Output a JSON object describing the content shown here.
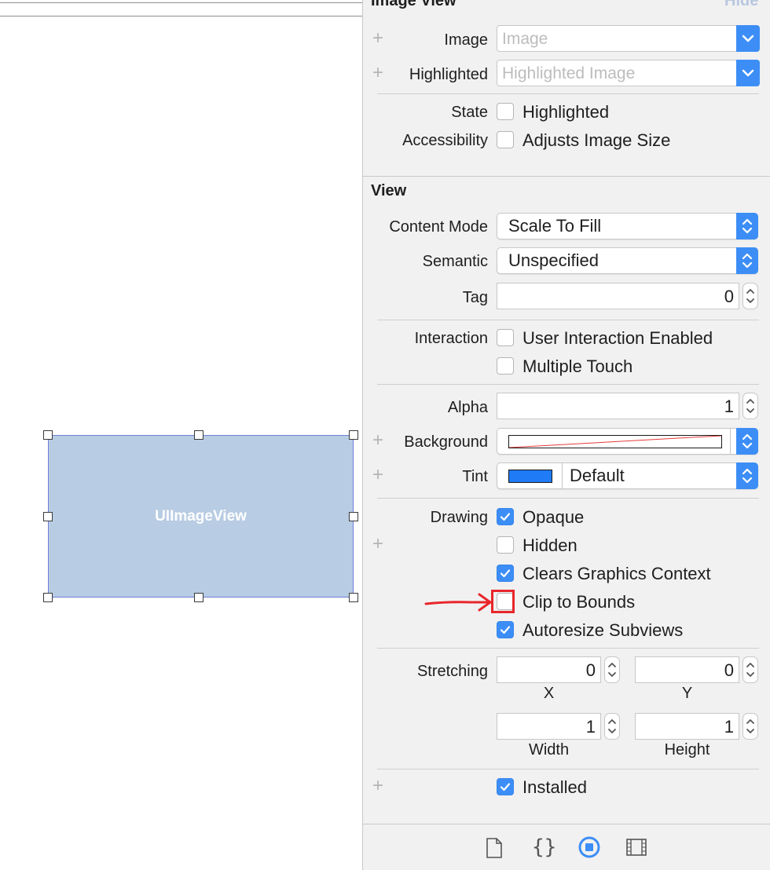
{
  "canvas": {
    "element_label": "UIImageView"
  },
  "image_view_section": {
    "title": "Image View",
    "hide_label": "Hide",
    "image_label": "Image",
    "image_placeholder": "Image",
    "highlighted_label": "Highlighted",
    "highlighted_placeholder": "Highlighted Image",
    "state_label": "State",
    "state_checkbox": {
      "label": "Highlighted",
      "checked": false
    },
    "accessibility_label": "Accessibility",
    "accessibility_checkbox": {
      "label": "Adjusts Image Size",
      "checked": false
    }
  },
  "view_section": {
    "title": "View",
    "content_mode_label": "Content Mode",
    "content_mode_value": "Scale To Fill",
    "semantic_label": "Semantic",
    "semantic_value": "Unspecified",
    "tag_label": "Tag",
    "tag_value": "0",
    "interaction_label": "Interaction",
    "user_interaction": {
      "label": "User Interaction Enabled",
      "checked": false
    },
    "multiple_touch": {
      "label": "Multiple Touch",
      "checked": false
    },
    "alpha_label": "Alpha",
    "alpha_value": "1",
    "background_label": "Background",
    "tint_label": "Tint",
    "tint_value": "Default",
    "tint_color": "#1f7cf6",
    "drawing_label": "Drawing",
    "opaque": {
      "label": "Opaque",
      "checked": true
    },
    "hidden": {
      "label": "Hidden",
      "checked": false
    },
    "clears_graphics": {
      "label": "Clears Graphics Context",
      "checked": true
    },
    "clip_to_bounds": {
      "label": "Clip to Bounds",
      "checked": false
    },
    "autoresize": {
      "label": "Autoresize Subviews",
      "checked": true
    },
    "stretching_label": "Stretching",
    "stretch_x": "0",
    "stretch_y": "0",
    "stretch_width": "1",
    "stretch_height": "1",
    "x_label": "X",
    "y_label": "Y",
    "width_label": "Width",
    "height_label": "Height",
    "installed": {
      "label": "Installed",
      "checked": true
    }
  },
  "bottom_bar": {
    "icons": [
      "file-icon",
      "braces-icon",
      "identity-circle-icon",
      "film-strip-icon"
    ]
  },
  "colors": {
    "accent": "#3c8ef6",
    "annotation_red": "#e8262a",
    "selection_fill": "#b8cce3",
    "selection_border": "#6f7fd8"
  }
}
